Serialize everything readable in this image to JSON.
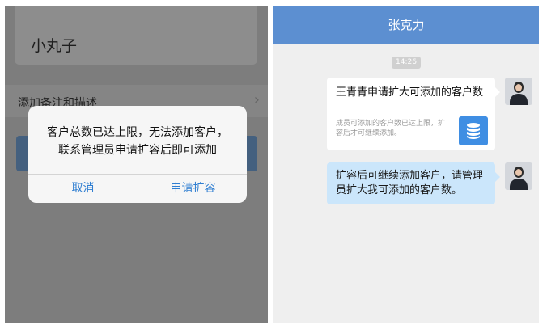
{
  "left": {
    "contact_name": "小丸子",
    "remark_row_label": "添加备注和描述",
    "chevron": "›",
    "dialog": {
      "line1": "客户总数已达上限，无法添加客户，",
      "line2": "联系管理员申请扩容后即可添加",
      "cancel_label": "取消",
      "confirm_label": "申请扩容"
    }
  },
  "right": {
    "title": "张克力",
    "time": "14:26",
    "card": {
      "title": "王青青申请扩大可添加的客户数",
      "desc": "成员可添加的客户数已达上限，扩容后才可继续添加。",
      "icon": "database-icon"
    },
    "message": "扩容后可继续添加客户，请管理员扩大我可添加的客户数。"
  },
  "colors": {
    "title_bar": "#5c8fd1",
    "dialog_button_text": "#2f7ed1",
    "blue_bubble": "#cbe6fb",
    "db_icon_bg": "#3f8ee3"
  }
}
